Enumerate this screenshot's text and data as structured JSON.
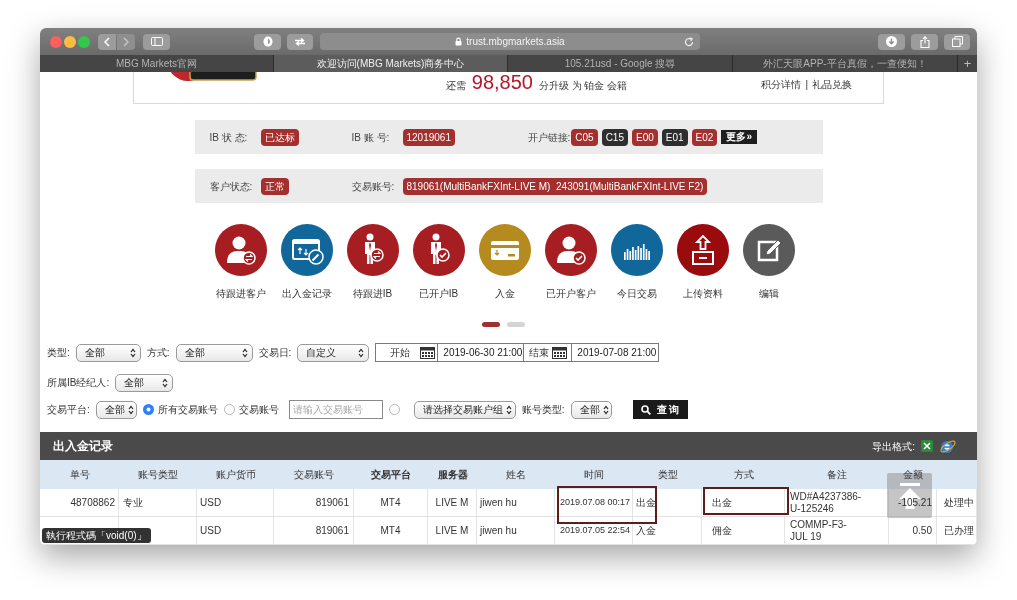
{
  "browser": {
    "address": "trust.mbgmarkets.asia",
    "tabs": [
      {
        "label": "MBG Markets官网",
        "selected": false
      },
      {
        "label": "欢迎访问(MBG Markets)商务中心",
        "selected": true
      },
      {
        "label": "105.21usd - Google 搜尋",
        "selected": false
      },
      {
        "label": "外汇天眼APP-平台真假，一查便知！",
        "selected": false
      }
    ],
    "new_tab": "+"
  },
  "points_card": {
    "message": "还需 **98,850** 分升级 为 铂金 会籍",
    "links": [
      "积分详情",
      "礼品兑换"
    ],
    "link_separator": "|"
  },
  "ib_panel": {
    "fields": [
      {
        "label": "IB 状 态:",
        "badges": [
          {
            "text": "已达标",
            "color": "#a3302e"
          }
        ]
      },
      {
        "label": "IB 账 号:",
        "badges": [
          {
            "text": "12019061",
            "color": "#a3302e"
          }
        ]
      },
      {
        "label": "开户链接:",
        "badges": [
          {
            "text": "C05",
            "color": "#a3302e"
          },
          {
            "text": "C15",
            "color": "#2e2e2e"
          },
          {
            "text": "E00",
            "color": "#a3302e"
          },
          {
            "text": "E01",
            "color": "#2e2e2e"
          },
          {
            "text": "E02",
            "color": "#a3302e"
          }
        ],
        "more": "更多»"
      }
    ]
  },
  "customer_panel": {
    "fields": [
      {
        "label": "客户状态:",
        "badges": [
          {
            "text": "正常",
            "color": "#a3302e"
          }
        ]
      },
      {
        "label": "交易账号:",
        "badges": [
          {
            "text": "819061(MultiBankFXInt-LIVE M)  243091(MultiBankFXInt-LIVE F2)",
            "color": "#a3302e"
          }
        ]
      }
    ]
  },
  "shortcuts": [
    {
      "label": "待跟进客户",
      "kind": "userswap",
      "color": "#a61e22"
    },
    {
      "label": "出入金记录",
      "kind": "ledger",
      "color": "#12679a"
    },
    {
      "label": "待跟进IB",
      "kind": "suitswap",
      "color": "#a61e22"
    },
    {
      "label": "已开户IB",
      "kind": "suitcheck",
      "color": "#a61e22"
    },
    {
      "label": "入金",
      "kind": "card",
      "color": "#b58a1e"
    },
    {
      "label": "已开户客户",
      "kind": "usercheck",
      "color": "#a61e22"
    },
    {
      "label": "今日交易",
      "kind": "chart",
      "color": "#12679a"
    },
    {
      "label": "上传资料",
      "kind": "upload",
      "color": "#990b0d"
    },
    {
      "label": "编辑",
      "kind": "edit",
      "color": "#5a5a5a"
    }
  ],
  "pager": [
    {
      "selected": true
    },
    {
      "selected": false
    }
  ],
  "filters": [
    [
      {
        "kind": "label",
        "text": "类型:"
      },
      {
        "kind": "select",
        "value": "全部"
      },
      {
        "kind": "label",
        "text": "方式:"
      },
      {
        "kind": "select",
        "value": "全部"
      },
      {
        "kind": "label",
        "text": "交易日:"
      },
      {
        "kind": "select",
        "value": "自定义"
      },
      {
        "kind": "daterange",
        "parts": [
          {
            "label": "开始",
            "value": "2019-06-30 21:00"
          },
          {
            "label": "结束",
            "value": "2019-07-08 21:00"
          }
        ]
      }
    ],
    [
      {
        "kind": "label",
        "text": "所属IB经纪人:"
      },
      {
        "kind": "select",
        "value": "全部"
      }
    ],
    [
      {
        "kind": "label",
        "text": "交易平台:"
      },
      {
        "kind": "select",
        "value": "全部"
      },
      {
        "kind": "radio",
        "label": "所有交易账号",
        "selected": true
      },
      {
        "kind": "radio",
        "label": "交易账号",
        "selected": false
      },
      {
        "kind": "input",
        "placeholder": "请输入交易账号"
      },
      {
        "kind": "radio",
        "selected": false
      },
      {
        "kind": "select",
        "value": "请选择交易账户组"
      },
      {
        "kind": "label",
        "text": "账号类型:"
      },
      {
        "kind": "select",
        "value": "全部"
      },
      {
        "kind": "button",
        "label": "查 询"
      }
    ]
  ],
  "records": {
    "title": "出入金记录",
    "export_label": "导出格式:",
    "columns": [
      {
        "label": "单号",
        "bold": false
      },
      {
        "label": "账号类型",
        "bold": false
      },
      {
        "label": "账户货币",
        "bold": false
      },
      {
        "label": "交易账号",
        "bold": false
      },
      {
        "label": "交易平台",
        "bold": true
      },
      {
        "label": "服务器",
        "bold": true
      },
      {
        "label": "姓名",
        "bold": false
      },
      {
        "label": "时间",
        "bold": false
      },
      {
        "label": "类型",
        "bold": false
      },
      {
        "label": "方式",
        "bold": false
      },
      {
        "label": "备注",
        "bold": false
      },
      {
        "label": "金额",
        "bold": false
      }
    ],
    "rows": [
      {
        "cells": [
          "48708862",
          "专业",
          "USD",
          "819061",
          "MT4",
          "LIVE M",
          "jiwen hu",
          "2019.07.08 00:17",
          "出金",
          "出金",
          "WD#A4237386-U-125246",
          "-105.21",
          "处理中"
        ]
      },
      {
        "cells": [
          null,
          null,
          "USD",
          "819061",
          "MT4",
          "LIVE M",
          "jiwen hu",
          "2019.07.05 22:54",
          "入金",
          "佣金",
          "COMMP-F3-JUL 19",
          "0.50",
          "已办理"
        ]
      }
    ]
  },
  "status_tooltip": "執行程式碼「void(0)」"
}
